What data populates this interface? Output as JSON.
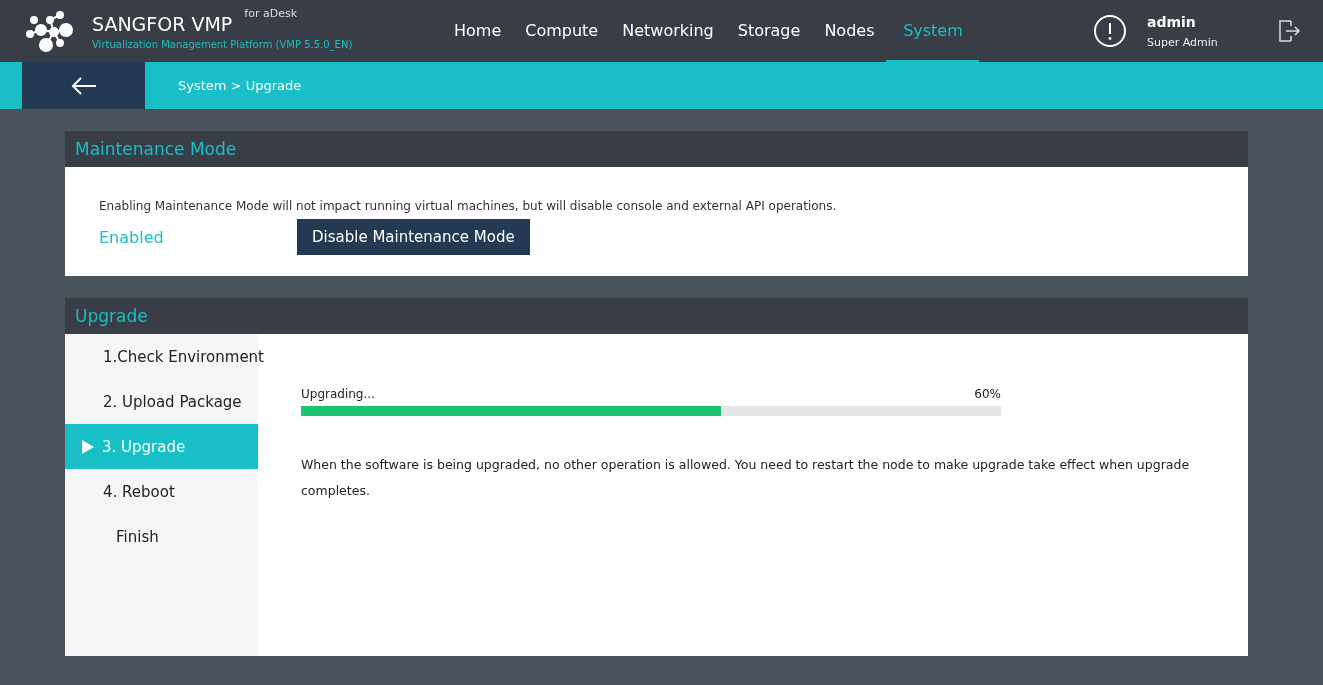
{
  "brand": {
    "name": "SANGFOR VMP",
    "edition": "for aDesk",
    "subtitle": "Virtualization Management Platform (VMP 5.5.0_EN)"
  },
  "nav": [
    {
      "label": "Home",
      "selected": false
    },
    {
      "label": "Compute",
      "selected": false
    },
    {
      "label": "Networking",
      "selected": false
    },
    {
      "label": "Storage",
      "selected": false
    },
    {
      "label": "Nodes",
      "selected": false
    },
    {
      "label": "System",
      "selected": true
    }
  ],
  "user": {
    "name": "admin",
    "role": "Super Admin"
  },
  "breadcrumb": "System > Upgrade",
  "maintenance": {
    "title": "Maintenance Mode",
    "description": "Enabling Maintenance Mode will not impact running virtual machines, but will disable console and external API operations.",
    "status": "Enabled",
    "button": "Disable Maintenance Mode"
  },
  "upgrade": {
    "title": "Upgrade",
    "steps": [
      {
        "label": "1.Check Environment",
        "kind": "step",
        "selected": false
      },
      {
        "label": "2. Upload Package",
        "kind": "step",
        "selected": false
      },
      {
        "label": "3. Upgrade",
        "kind": "step",
        "selected": true
      },
      {
        "label": "4. Reboot",
        "kind": "step",
        "selected": false
      },
      {
        "label": "Finish",
        "kind": "final",
        "selected": false
      }
    ],
    "progress": {
      "label": "Upgrading...",
      "reading": "60%",
      "level": 0.6
    },
    "note": "When the software is being upgraded, no other operation is allowed. You need to restart the node to make upgrade take effect when upgrade completes."
  }
}
